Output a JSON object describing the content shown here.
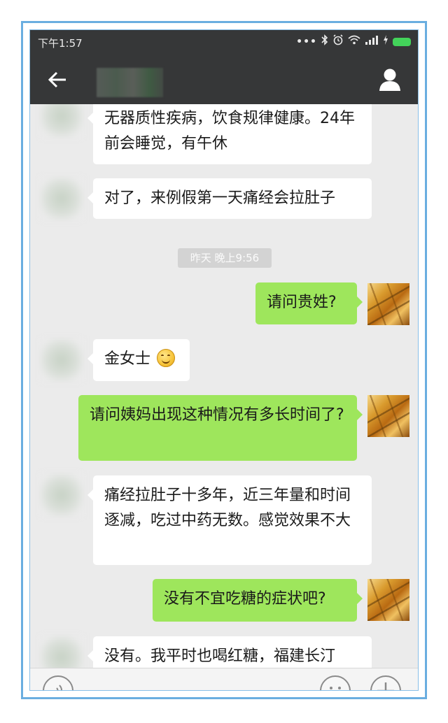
{
  "status_bar": {
    "time": "下午1:57",
    "icons": [
      "more-dots-icon",
      "bluetooth-icon",
      "alarm-icon",
      "wifi-icon",
      "signal-icon",
      "charging-icon",
      "battery-icon"
    ]
  },
  "nav": {
    "contact_name": "",
    "back_icon": "back-arrow-icon",
    "profile_icon": "person-icon"
  },
  "messages": [
    {
      "from": "them",
      "text": "无器质性疾病，饮食规律健康。24年前会睡觉，有午休"
    },
    {
      "from": "them",
      "text": "对了，来例假第一天痛经会拉肚子"
    },
    {
      "type": "time",
      "text": "昨天 晚上9:56"
    },
    {
      "from": "me",
      "text": "请问贵姓?"
    },
    {
      "from": "them",
      "text": "金女士",
      "emoji": "smile-emoji"
    },
    {
      "from": "me",
      "text": "请问姨妈出现这种情况有多长时间了?"
    },
    {
      "from": "them",
      "text": "痛经拉肚子十多年，近三年量和时间逐减，吃过中药无数。感觉效果不大"
    },
    {
      "from": "me",
      "text": "没有不宜吃糖的症状吧?"
    },
    {
      "from": "them",
      "text": "没有。我平时也喝红糖，福建长汀"
    }
  ],
  "input_bar": {
    "voice_icon": "voice-icon",
    "emoji_icon": "emoji-face-icon",
    "more_icon": "plus-icon"
  },
  "colors": {
    "frame": "#6aaee0",
    "header": "#363738",
    "chat_bg": "#ebebeb",
    "bubble_me": "#9ee65c",
    "bubble_them": "#ffffff",
    "battery": "#43d35a"
  }
}
